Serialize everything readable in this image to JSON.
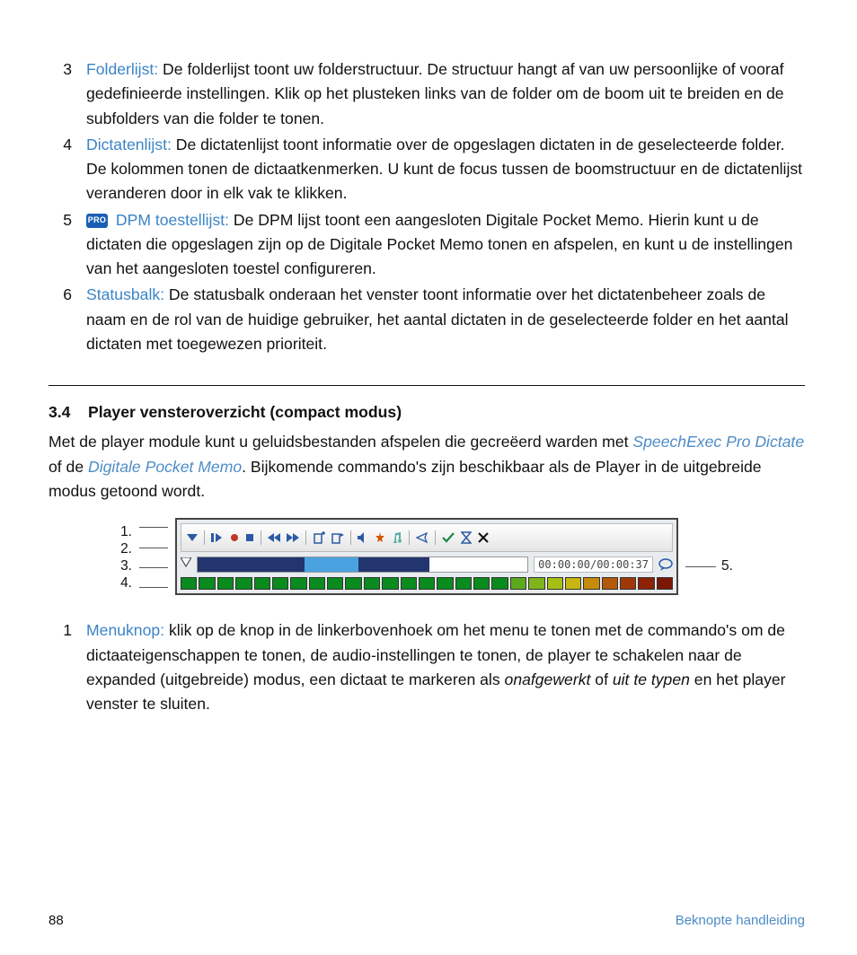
{
  "list": {
    "n3": "3",
    "t3": "Folderlijst:",
    "b3": " De folderlijst toont uw folderstructuur. De structuur hangt af van uw persoonlijke of vooraf gedefinieerde instellingen. Klik op het plusteken links van de folder om de boom uit te breiden en de subfolders van die folder te tonen.",
    "n4": "4",
    "t4": "Dictatenlijst:",
    "b4": " De dictatenlijst toont informatie over de opgeslagen dictaten in de geselecteerde folder. De kolommen tonen de dictaatkenmerken. U kunt de focus tussen de boomstructuur en de dictatenlijst veranderen door in elk vak te klikken.",
    "n5": "5",
    "pro": "PRO",
    "t5": "DPM toestellijst:",
    "b5": " De DPM lijst toont een aangesloten Digitale Pocket Memo. Hierin kunt u de dictaten die opgeslagen zijn op de Digitale Pocket Memo tonen en afspelen, en kunt u de instellingen van het aangesloten toestel configureren.",
    "n6": "6",
    "t6": "Statusbalk:",
    "b6": " De statusbalk onderaan het venster toont informatie over het dictatenbeheer zoals de naam en de rol van de huidige gebruiker, het aantal dictaten in de geselecteerde folder en het aantal dictaten met toegewezen prioriteit."
  },
  "section": {
    "num": "3.4",
    "title": "Player vensteroverzicht (compact modus)",
    "para_a": "Met de player module kunt u geluidsbestanden afspelen die gecreëerd warden met ",
    "link1": "SpeechExec Pro Dictate",
    "para_b": " of de ",
    "link2": "Digitale Pocket Memo",
    "para_c": ". Bijkomende commando's zijn beschikbaar als de Player in de uitgebreide modus getoond wordt."
  },
  "diagram": {
    "l1": "1.",
    "l2": "2.",
    "l3": "3.",
    "l4": "4.",
    "r5": "5.",
    "timecode": "00:00:00/00:00:37"
  },
  "callout": {
    "num": "1",
    "term": "Menuknop:",
    "body_a": " klik op de knop in de linkerbovenhoek om het menu te tonen met de commando's om de dictaateigenschappen te tonen, de audio-instellingen te tonen, de player te schakelen naar de expanded (uitgebreide) modus, een dictaat te markeren als ",
    "em1": "onafgewerkt",
    "body_b": " of ",
    "em2": "uit te typen",
    "body_c": " en het player venster te sluiten."
  },
  "footer": {
    "page": "88",
    "guide": "Beknopte handleiding"
  },
  "chart_data": {
    "type": "area",
    "title": "Player window timeline",
    "x": [
      0,
      18,
      37
    ],
    "segments": [
      {
        "start": 0,
        "end": 12,
        "color": "#23356f"
      },
      {
        "start": 12,
        "end": 18,
        "color": "#4aa3e0"
      },
      {
        "start": 18,
        "end": 26,
        "color": "#22356e"
      },
      {
        "start": 26,
        "end": 37,
        "color": "#ffffff"
      }
    ],
    "current_time": "00:00:00",
    "total_time": "00:00:37",
    "vu_meter_colors": [
      "#0a8b1e",
      "#0a8b1e",
      "#0a8b1e",
      "#0a8b1e",
      "#0a8b1e",
      "#0a8b1e",
      "#0a8b1e",
      "#0a8b1e",
      "#0a8b1e",
      "#0a8b1e",
      "#0a8b1e",
      "#0a8b1e",
      "#0a8b1e",
      "#0a8b1e",
      "#0a8b1e",
      "#0a8b1e",
      "#0a8b1e",
      "#0a8b1e",
      "#5caa1c",
      "#7fb51a",
      "#a7bf14",
      "#c6b60f",
      "#c68a0c",
      "#b35a0a",
      "#a03908",
      "#8c2306",
      "#7a1705"
    ]
  }
}
